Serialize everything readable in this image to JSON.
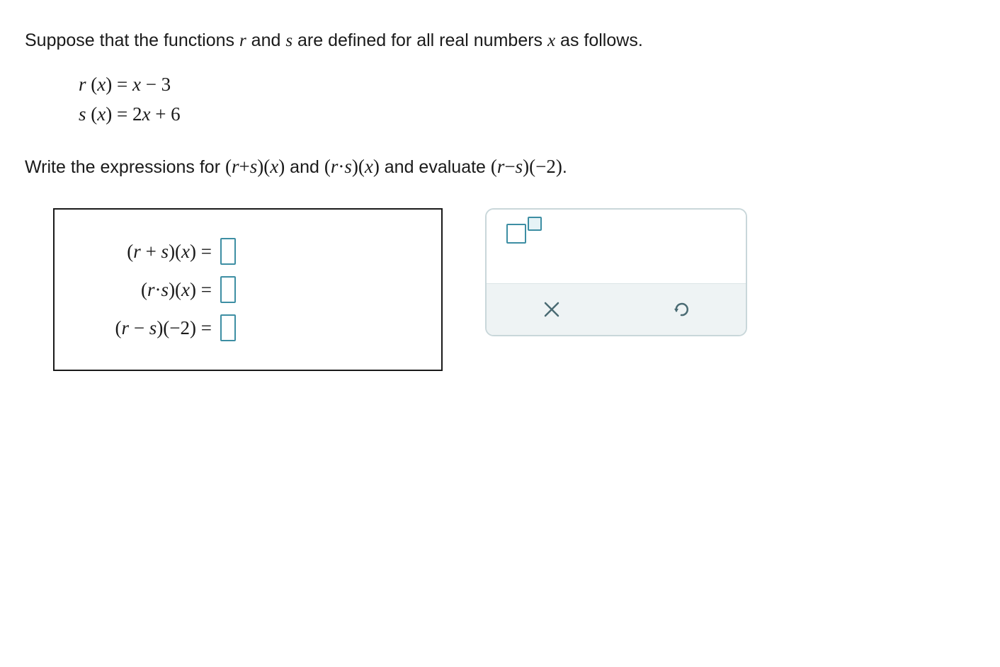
{
  "problem": {
    "intro_prefix": "Suppose that the functions ",
    "intro_mid1": " and ",
    "intro_mid2": " are defined for all real numbers ",
    "intro_suffix": " as follows.",
    "var_r": "r",
    "var_s": "s",
    "var_x": "x",
    "def_r": "r (x) = x − 3",
    "def_s": "s (x) = 2x + 6",
    "task_prefix": "Write the expressions for ",
    "task_mid1": " and ",
    "task_mid2": " and evaluate ",
    "task_suffix": ".",
    "expr_rs_sum": "(r+s)(x)",
    "expr_rs_prod": "(r·s)(x)",
    "expr_rs_diff": "(r−s)(−2)"
  },
  "answers": {
    "row1_label": "(r + s)(x) = ",
    "row2_label": "(r·s)(x) = ",
    "row3_label": "(r − s)(−2) = ",
    "row1_value": "",
    "row2_value": "",
    "row3_value": ""
  },
  "tools": {
    "exponent_tool": "exponent-input",
    "clear": "clear",
    "undo": "undo"
  }
}
